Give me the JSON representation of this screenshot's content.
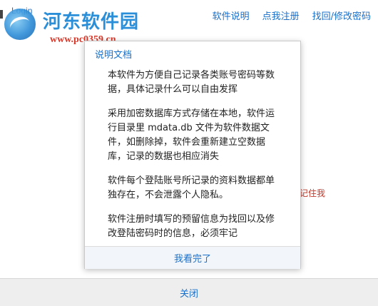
{
  "app": {
    "login_tab": "Login"
  },
  "watermark": {
    "name": "河东软件园",
    "url": "www.pc0359.cn"
  },
  "nav": {
    "items": [
      {
        "label": "软件说明"
      },
      {
        "label": "点我注册"
      },
      {
        "label": "找回/修改密码"
      }
    ]
  },
  "background": {
    "partial_text": "记住我"
  },
  "modal": {
    "title": "说明文档",
    "paragraphs": [
      "本软件为方便自己记录各类账号密码等数据，具体记录什么可以自由发挥",
      "采用加密数据库方式存储在本地，软件运行目录里 mdata.db 文件为软件数据文件，如删除掉，软件会重新建立空数据库，记录的数据也相应消失",
      "软件每个登陆账号所记录的资料数据都单独存在，不会泄露个人隐私。",
      "软件注册时填写的预留信息为找回以及修改登陆密码时的信息，必须牢记"
    ],
    "confirm_label": "我看完了"
  },
  "footer": {
    "close_label": "关闭"
  },
  "colors": {
    "link": "#1a6fc9",
    "alert": "#c0392b"
  }
}
